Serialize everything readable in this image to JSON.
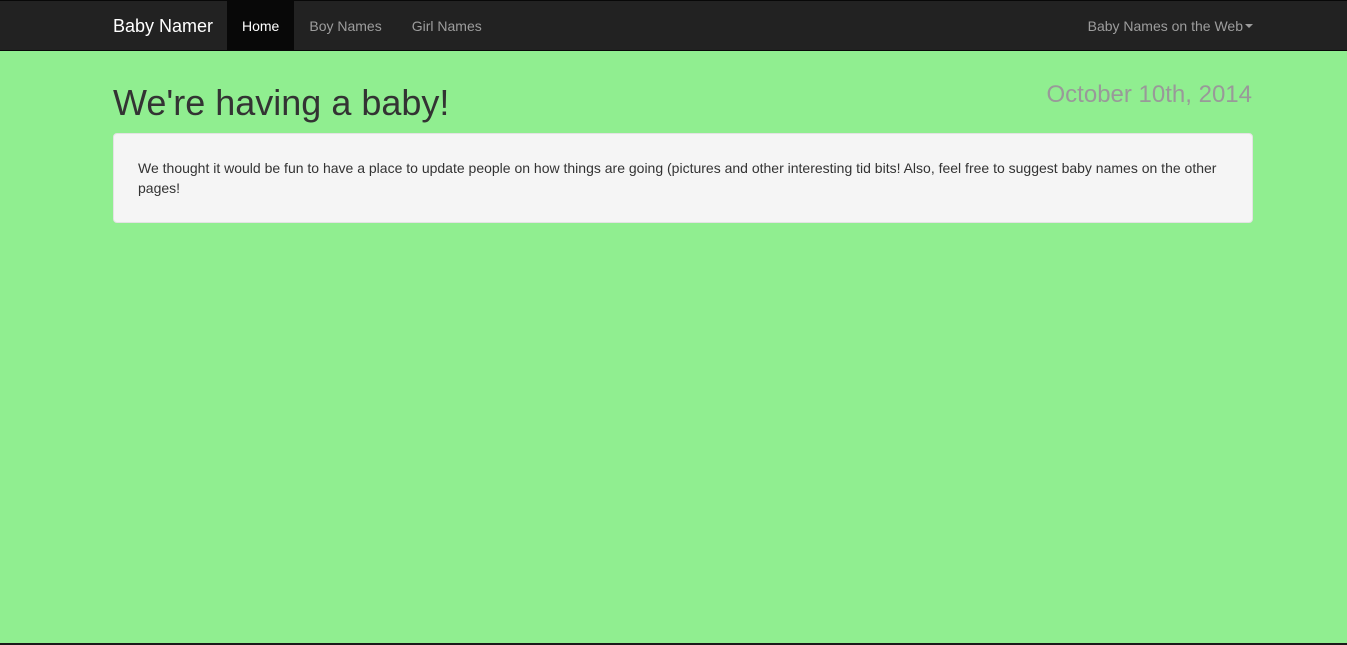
{
  "navbar": {
    "brand": "Baby Namer",
    "items": [
      {
        "label": "Home",
        "active": true
      },
      {
        "label": "Boy Names",
        "active": false
      },
      {
        "label": "Girl Names",
        "active": false
      }
    ],
    "dropdown_label": "Baby Names on the Web",
    "dropdown_icon": "caret-down-icon"
  },
  "main": {
    "title": "We're having a baby!",
    "date": "October 10th, 2014",
    "body": "We thought it would be fun to have a place to update people on how things are going (pictures and other interesting tid bits! Also, feel free to suggest baby names on the other pages!"
  },
  "colors": {
    "page_background": "#90EE90",
    "navbar_background": "#222222",
    "active_nav_background": "#080808"
  }
}
